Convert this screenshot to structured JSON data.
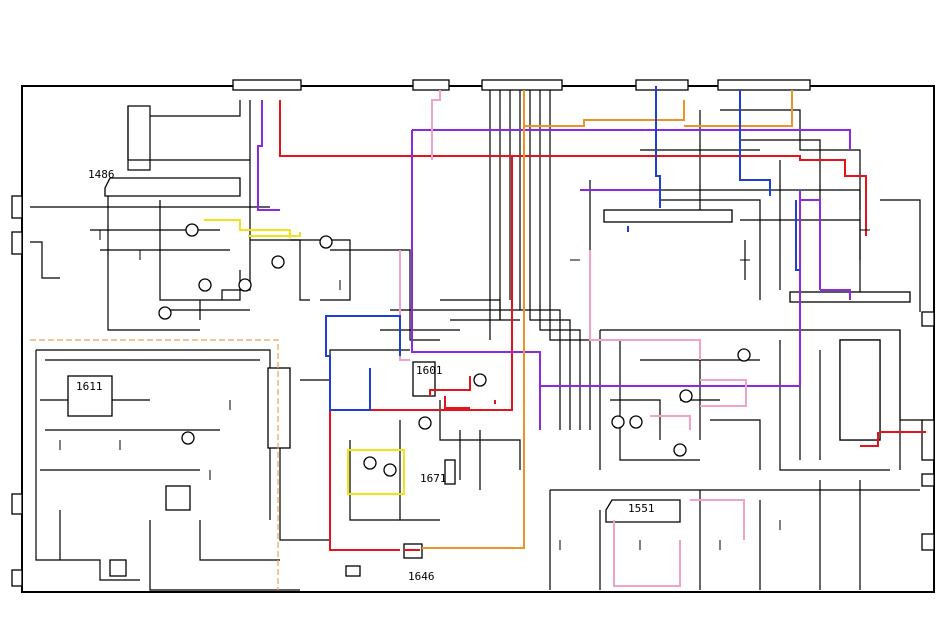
{
  "labels": {
    "ic_1486": "1486",
    "ic_1611": "1611",
    "ic_1601": "1601",
    "ic_1671": "1671",
    "ic_1551": "1551",
    "ic_1646": "1646"
  },
  "highlight_colors": {
    "red": "#e3141b",
    "purple": "#8a2be2",
    "orange": "#f0922a",
    "pink": "#f2a2c8",
    "blue": "#1f3fd0",
    "yellow": "#f2e21c",
    "dashed_orange": "#f0a050"
  }
}
